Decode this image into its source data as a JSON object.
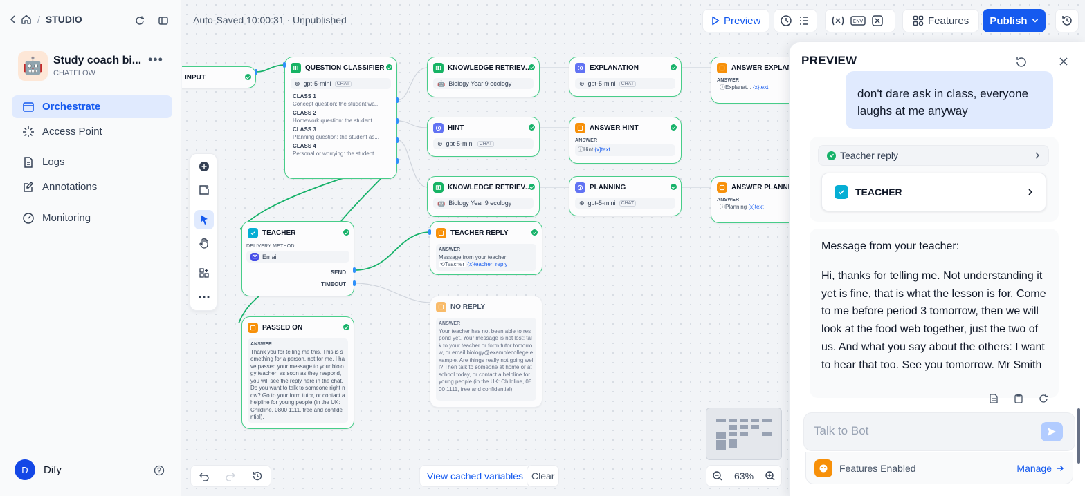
{
  "sidebar": {
    "studio_label": "STUDIO",
    "app_name": "Study coach bi...",
    "app_type": "CHATFLOW",
    "app_avatar": "robot-face",
    "nav": [
      "Orchestrate",
      "Access Point",
      "Logs",
      "Annotations",
      "Monitoring"
    ],
    "user_initial": "D",
    "user_name": "Dify"
  },
  "toolbar": {
    "autosave": "Auto-Saved 10:00:31 · Unpublished",
    "preview": "Preview",
    "features": "Features",
    "publish": "Publish"
  },
  "nodes": {
    "input": {
      "title": "INPUT"
    },
    "classifier": {
      "title": "QUESTION CLASSIFIER",
      "model": "gpt-5-mini",
      "mode": "CHAT",
      "classes": [
        {
          "name": "CLASS 1",
          "desc": "Concept question: the student wa..."
        },
        {
          "name": "CLASS 2",
          "desc": "Homework question: the student ..."
        },
        {
          "name": "CLASS 3",
          "desc": "Planning question: the student as..."
        },
        {
          "name": "CLASS 4",
          "desc": "Personal or worrying: the student ..."
        }
      ]
    },
    "kr1": {
      "title": "KNOWLEDGE RETRIEVAL",
      "kb": "Biology Year 9 ecology"
    },
    "kr2": {
      "title": "KNOWLEDGE RETRIEVA...",
      "kb": "Biology Year 9 ecology"
    },
    "hint": {
      "title": "HINT",
      "model": "gpt-5-mini",
      "mode": "CHAT"
    },
    "explanation": {
      "title": "EXPLANATION",
      "model": "gpt-5-mini",
      "mode": "CHAT"
    },
    "planning": {
      "title": "PLANNING",
      "model": "gpt-5-mini",
      "mode": "CHAT"
    },
    "answer_hint": {
      "title": "ANSWER HINT",
      "label": "ANSWER",
      "ref": "Hint",
      "var": "{x}text"
    },
    "answer_expl": {
      "title": "ANSWER EXPLANATION",
      "label": "ANSWER",
      "ref": "Explanat...",
      "var": "{x}text"
    },
    "answer_plan": {
      "title": "ANSWER PLANNING",
      "label": "ANSWER",
      "ref": "Planning",
      "var": "{x}text"
    },
    "teacher": {
      "title": "TEACHER",
      "label": "DELIVERY METHOD",
      "method": "Email",
      "send": "SEND",
      "timeout": "TIMEOUT"
    },
    "teacher_reply": {
      "title": "TEACHER REPLY",
      "label": "ANSWER",
      "text": "Message from your teacher:",
      "ref": "Teacher",
      "var": "{x}teacher_reply"
    },
    "passed_on": {
      "title": "PASSED ON",
      "label": "ANSWER",
      "text": "Thank you for telling me this. This is something for a person, not for me. I have passed your message to your biology teacher; as soon as they respond, you will see the reply here in the chat. Do you want to talk to someone right now? Go to your form tutor, or contact a helpline for young people (in the UK: Childline, 0800 1111, free and confidential)."
    },
    "no_reply": {
      "title": "NO REPLY",
      "label": "ANSWER",
      "text": "Your teacher has not been able to respond yet. Your message is not lost: talk to your teacher or form tutor tomorrow, or email biology@examplecollege.example. Are things really not going well? Then talk to someone at home or at school today, or contact a helpline for young people (in the UK: Childline, 0800 1111, free and confidential)."
    }
  },
  "bottom": {
    "cached": "View cached variables",
    "clear": "Clear",
    "zoom": "63%"
  },
  "preview": {
    "title": "PREVIEW",
    "user_message": "don't dare ask in class, everyone laughs at me anyway",
    "node_status": "Teacher reply",
    "node_name": "TEACHER",
    "reply_intro": "Message from your teacher:",
    "reply_body": "Hi, thanks for telling me. Not understanding it yet is fine, that is what the lesson is for. Come to me before period 3 tomorrow, then we will look at the food web together, just the two of us. And what you say about the others: I want to hear that too. See you tomorrow. Mr Smith",
    "input_placeholder": "Talk to Bot",
    "features_enabled": "Features Enabled",
    "manage": "Manage"
  },
  "colors": {
    "accent": "#155aef",
    "success": "#17b26a",
    "wire": "#17b26a"
  }
}
